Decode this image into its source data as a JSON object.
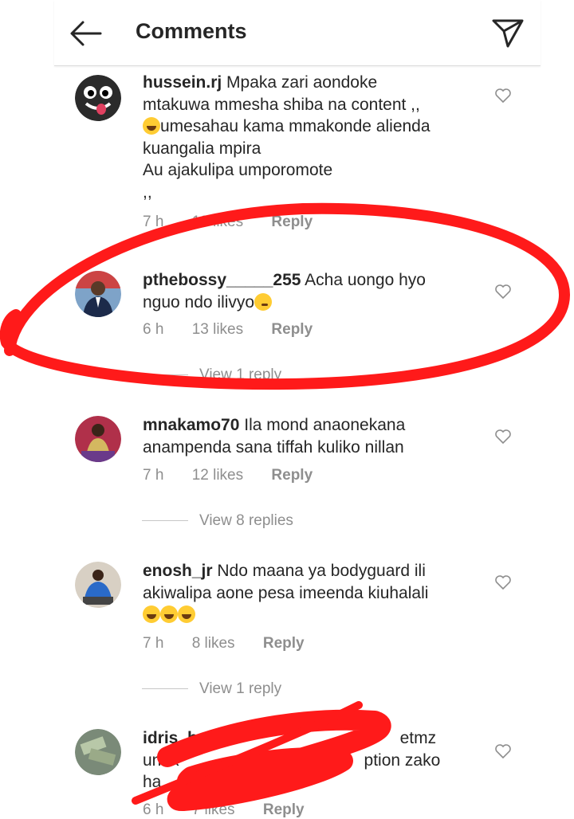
{
  "header": {
    "title": "Comments",
    "back_icon": "arrow-left-icon",
    "send_icon": "paper-plane-icon"
  },
  "comments": [
    {
      "username": "hussein.rj",
      "lines": [
        "Mpaka zari aondoke",
        "mtakuwa mmesha shiba na content ,,",
        "umesahau kama mmakonde alienda",
        "kuangalia mpira",
        "Au ajakulipa umporomote",
        ",,"
      ],
      "time": "7 h",
      "likes": "19 likes",
      "reply": "Reply"
    },
    {
      "username": "pthebossy_____255",
      "lines": [
        "Acha uongo hyo",
        "nguo ndo ilivyo"
      ],
      "time": "6 h",
      "likes": "13 likes",
      "reply": "Reply",
      "view_replies": "View 1 reply"
    },
    {
      "username": "mnakamo70",
      "lines": [
        "Ila mond anaonekana",
        "anampenda sana tiffah kuliko nillan"
      ],
      "time": "7 h",
      "likes": "12 likes",
      "reply": "Reply",
      "view_replies": "View 8 replies"
    },
    {
      "username": "enosh_jr",
      "lines": [
        "Ndo maana ya bodyguard ili",
        "akiwalipa aone pesa imeenda kiuhalali"
      ],
      "time": "7 h",
      "likes": "8 likes",
      "reply": "Reply",
      "view_replies": "View 1 reply"
    },
    {
      "username": "idris_baro",
      "lines": [
        "U",
        "etmz",
        "unak",
        "ption zako",
        "ha"
      ],
      "time": "6 h",
      "likes": "7 likes",
      "reply": "Reply"
    }
  ],
  "colors": {
    "annotation_red": "#ff1a1a",
    "text": "#262626",
    "muted": "#8e8e8e"
  }
}
